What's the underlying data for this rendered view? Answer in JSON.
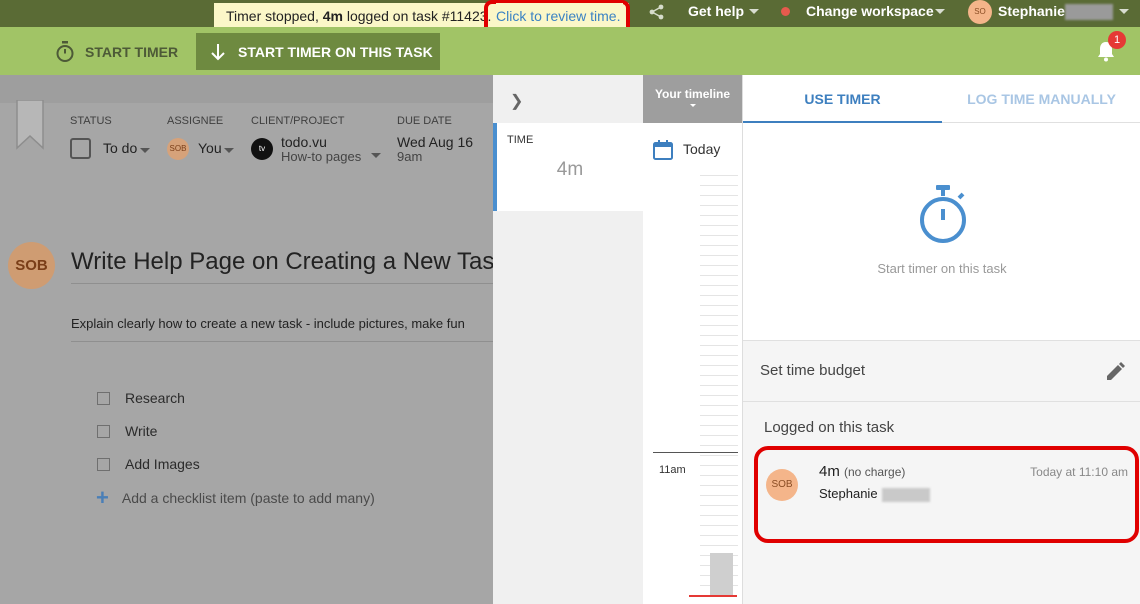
{
  "topbar": {
    "toast": {
      "prefix": "Timer stopped, ",
      "duration": "4m",
      "mid": " logged on task #11423.",
      "link": "Click to review time."
    },
    "get_help": "Get help",
    "change_workspace": "Change workspace",
    "user_initials": "SO",
    "user_name": "Stephanie",
    "workspace_status_color": "#e65a4d",
    "share_icon": "share-icon"
  },
  "actionbar": {
    "start_timer": "START TIMER",
    "start_timer_on_task": "START TIMER ON THIS TASK",
    "notification_count": "1"
  },
  "task": {
    "status": {
      "header": "STATUS",
      "value": "To do"
    },
    "assignee": {
      "header": "ASSIGNEE",
      "initials": "SOB",
      "value": "You"
    },
    "client_project": {
      "header": "CLIENT/PROJECT",
      "logo": "tv",
      "client": "todo.vu",
      "project": "How-to pages"
    },
    "due_date": {
      "header": "DUE DATE",
      "date": "Wed Aug 16",
      "time": "9am"
    },
    "owner_initials": "SOB",
    "title": "Write Help Page on Creating a New Task",
    "description": "Explain clearly how to create a new task - include pictures, make fun",
    "checklist": [
      "Research",
      "Write",
      "Add Images"
    ],
    "add_checklist": "Add a checklist item (paste to add many)"
  },
  "timeline": {
    "card_label": "TIME",
    "card_value": "4m",
    "header": "Your timeline",
    "today": "Today",
    "hour_label": "11am"
  },
  "panel": {
    "tabs": {
      "use_timer": "USE TIMER",
      "log_manually": "LOG TIME MANUALLY"
    },
    "start_timer_on_task": "Start timer on this task",
    "set_budget": "Set time budget",
    "logged_title": "Logged on this task",
    "entry": {
      "initials": "SOB",
      "duration": "4m",
      "charge": "(no charge)",
      "user": "Stephanie",
      "time": "Today at 11:10 am"
    }
  },
  "colors": {
    "accent_blue": "#3d7fbf",
    "action_green": "#a1c466",
    "highlight_red": "#e00000"
  }
}
